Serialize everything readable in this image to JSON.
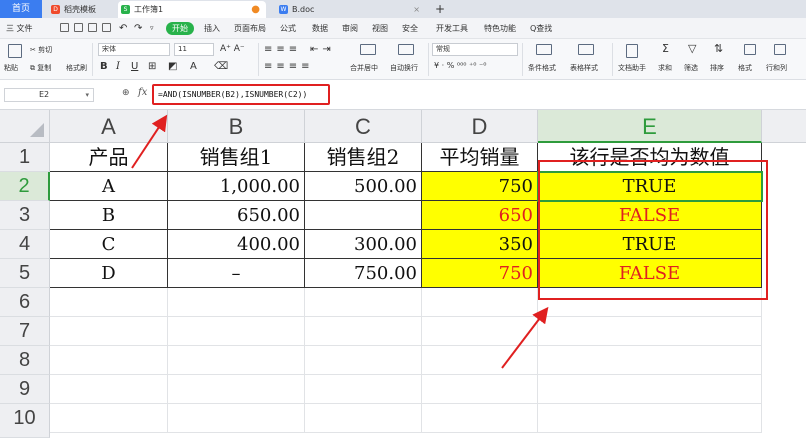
{
  "tabs": {
    "home": "首页",
    "items": [
      {
        "label": "稻壳模板",
        "icon_color": "#f04a2b",
        "icon_text": "D"
      },
      {
        "label": "工作簿1",
        "icon_color": "#28b24b",
        "icon_text": "S"
      },
      {
        "label": "B.doc",
        "icon_color": "#3b7df0",
        "icon_text": "W"
      }
    ],
    "add": "+"
  },
  "menu": {
    "file": "三 文件",
    "start": "开始",
    "items": [
      "插入",
      "页面布局",
      "公式",
      "数据",
      "审阅",
      "视图",
      "安全",
      "开发工具",
      "特色功能"
    ],
    "search": "Q查找"
  },
  "ribbon": {
    "paste": "粘贴",
    "cut": "剪切",
    "copy": "复制",
    "format_painter": "格式刷",
    "font_name": "宋体",
    "font_size": "11",
    "bold": "B",
    "italic": "I",
    "underline": "U",
    "merge": "合并居中",
    "wrap": "自动换行",
    "number_format": "常规",
    "conditional_format": "条件格式",
    "table_style": "表格样式",
    "doc_helper": "文档助手",
    "sum": "求和",
    "filter": "筛选",
    "sort": "排序",
    "format": "格式",
    "rows_cols": "行和列"
  },
  "formula_bar": {
    "cell_ref": "E2",
    "fx": "fx",
    "formula": "=AND(ISNUMBER(B2),ISNUMBER(C2))"
  },
  "sheet": {
    "columns": [
      "A",
      "B",
      "C",
      "D",
      "E"
    ],
    "rows": [
      "1",
      "2",
      "3",
      "4",
      "5",
      "6",
      "7",
      "8",
      "9",
      "10"
    ],
    "header": [
      "产品",
      "销售组1",
      "销售组2",
      "平均销量",
      "该行是否均为数值"
    ],
    "data": [
      [
        "A",
        "1,000.00",
        "500.00",
        "750",
        "TRUE"
      ],
      [
        "B",
        "650.00",
        "",
        "650",
        "FALSE"
      ],
      [
        "C",
        "400.00",
        "300.00",
        "350",
        "TRUE"
      ],
      [
        "D",
        "–",
        "750.00",
        "750",
        "FALSE"
      ]
    ],
    "colors": {
      "highlight": "#ffff00",
      "false_text": "#e02020",
      "selection": "#2e9b3c",
      "annotation": "#e02020"
    }
  }
}
